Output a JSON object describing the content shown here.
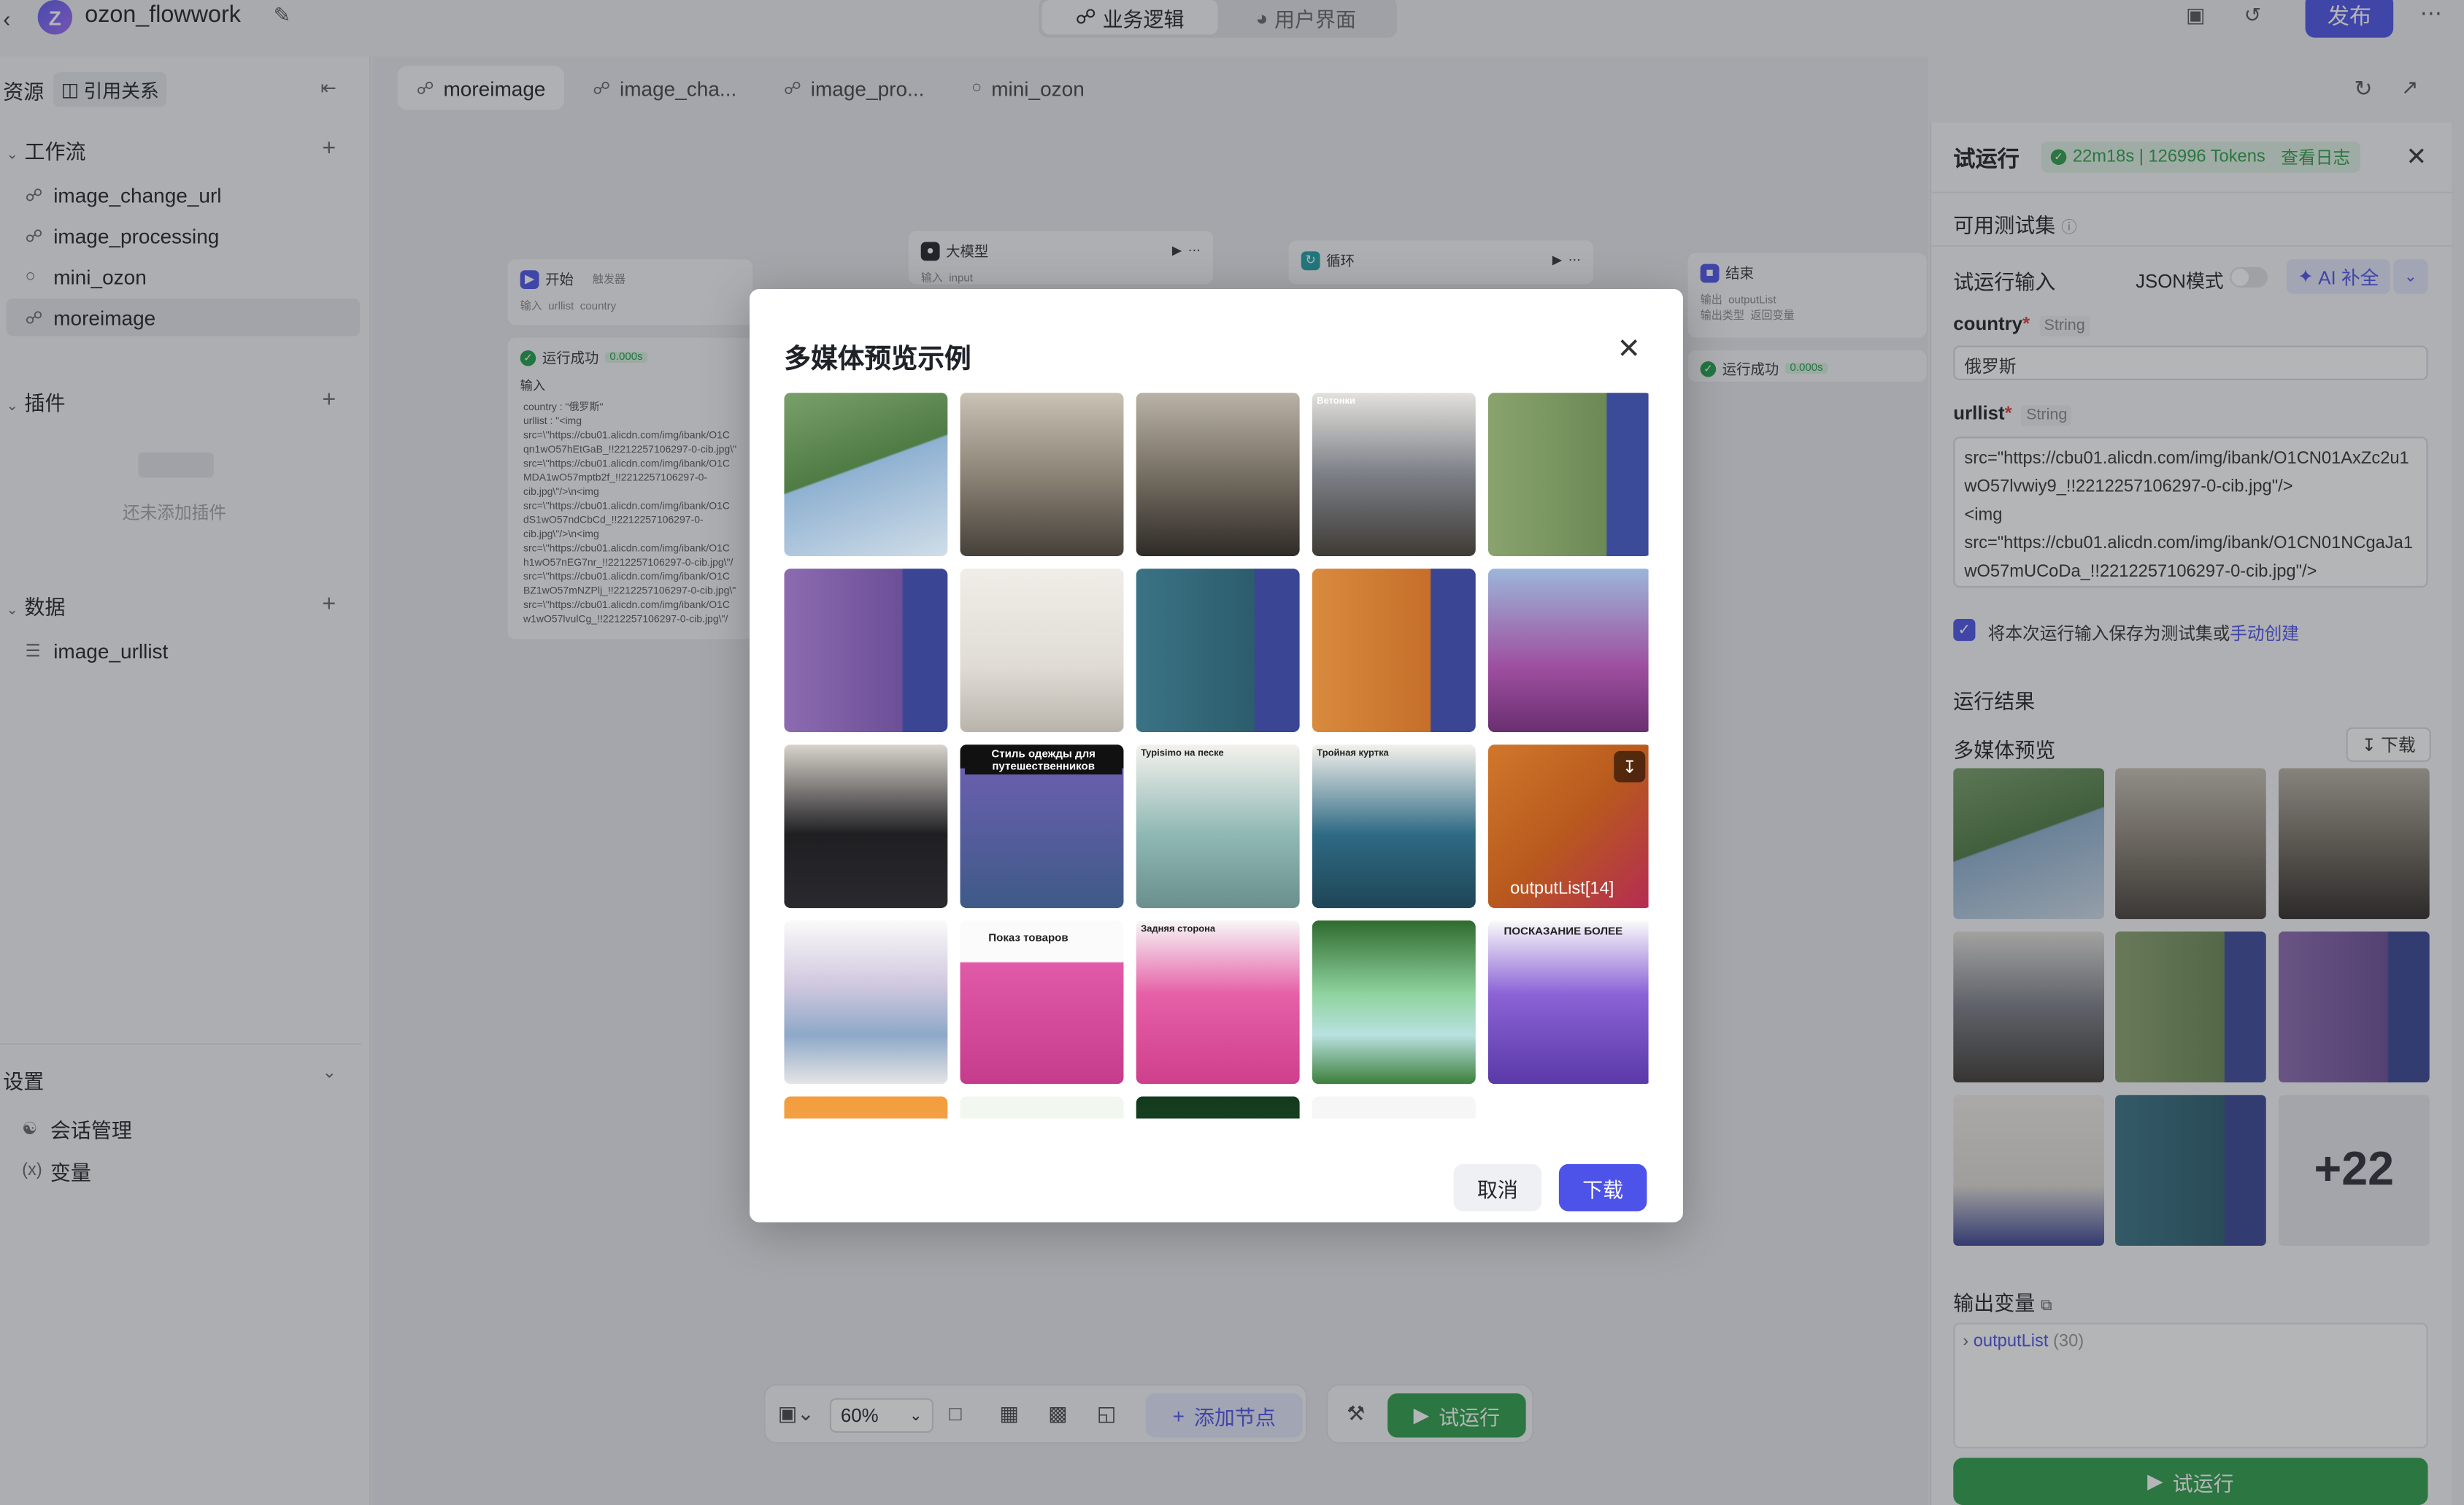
{
  "app": {
    "title": "ozon_flowwork",
    "tabs": [
      {
        "label": "业务逻辑",
        "icon": "flow-icon"
      },
      {
        "label": "用户界面",
        "icon": "palette-icon"
      }
    ],
    "publish_label": "发布"
  },
  "sidebar": {
    "resources_label": "资源",
    "references_label": "引用关系",
    "workflow_section": "工作流",
    "workflows": [
      {
        "label": "image_change_url",
        "icon": "workflow-icon"
      },
      {
        "label": "image_processing",
        "icon": "workflow-icon"
      },
      {
        "label": "mini_ozon",
        "icon": "chat-flow-icon"
      },
      {
        "label": "moreimage",
        "icon": "workflow-icon"
      }
    ],
    "plugin_section": "插件",
    "plugin_empty": "还未添加插件",
    "data_section": "数据",
    "data_items": [
      {
        "label": "image_urllist",
        "icon": "database-icon"
      }
    ],
    "settings_section": "设置",
    "settings_items": [
      {
        "label": "会话管理",
        "icon": "conversation-icon"
      },
      {
        "label": "变量",
        "icon": "variable-icon"
      }
    ]
  },
  "canvas": {
    "tabs": [
      {
        "label": "moreimage"
      },
      {
        "label": "image_cha..."
      },
      {
        "label": "image_pro..."
      },
      {
        "label": "mini_ozon"
      }
    ],
    "nodes": {
      "start": {
        "title": "开始",
        "tag": "触发器",
        "in_label": "输入",
        "fields": [
          "urllist",
          "country"
        ],
        "status": "运行成功",
        "time": "0.000s",
        "input_label": "输入",
        "code": "country : \"俄罗斯\"\nurllist : \"<img\nsrc=\\\"https://cbu01.alicdn.com/img/ibank/O1C\nqn1wO57hEtGaB_!!2212257106297-0-cib.jpg\\\"\nsrc=\\\"https://cbu01.alicdn.com/img/ibank/O1C\nMDA1wO57mptb2f_!!2212257106297-0-\ncib.jpg\\\"/>\\n<img\nsrc=\\\"https://cbu01.alicdn.com/img/ibank/O1C\ndS1wO57ndCbCd_!!2212257106297-0-\ncib.jpg\\\"/>\\n<img\nsrc=\\\"https://cbu01.alicdn.com/img/ibank/O1C\nh1wO57nEG7nr_!!2212257106297-0-cib.jpg\\\"/\nsrc=\\\"https://cbu01.alicdn.com/img/ibank/O1C\nBZ1wO57mNZPlj_!!2212257106297-0-cib.jpg\\\"\nsrc=\\\"https://cbu01.alicdn.com/img/ibank/O1C\nw1wO57lvulCg_!!2212257106297-0-cib.jpg\\\"/"
      },
      "llm": {
        "title": "大模型",
        "in_label": "输入",
        "field": "input"
      },
      "loop": {
        "title": "循环"
      },
      "end": {
        "title": "结束",
        "out_label": "输出",
        "field": "outputList",
        "out_type_label": "输出类型",
        "out_type": "返回变量",
        "status": "运行成功",
        "time": "0.000s"
      }
    },
    "zoom": "60%",
    "add_node_label": "添加节点",
    "run_label": "试运行"
  },
  "right_panel": {
    "title": "试运行",
    "badge": "22m18s | 126996 Tokens",
    "log_link": "查看日志",
    "test_set_label": "可用测试集",
    "input_label": "试运行输入",
    "json_mode_label": "JSON模式",
    "ai_fill_label": "AI 补全",
    "country_label": "country",
    "country_type": "String",
    "country_value": "俄罗斯",
    "urllist_label": "urllist",
    "urllist_type": "String",
    "urllist_value": "src=\"https://cbu01.alicdn.com/img/ibank/O1CN01AxZc2u1wO57lvwiy9_!!2212257106297-0-cib.jpg\"/>\n<img\nsrc=\"https://cbu01.alicdn.com/img/ibank/O1CN01NCgaJa1wO57mUCoDa_!!2212257106297-0-cib.jpg\"/>",
    "save_text": "将本次运行输入保存为测试集或",
    "save_link": "手动创建",
    "result_label": "运行结果",
    "media_preview_label": "多媒体预览",
    "download_label": "下载",
    "more_count": "+22",
    "output_var_label": "输出变量",
    "output_item": "outputList",
    "output_count": "(30)",
    "run_label": "试运行"
  },
  "modal": {
    "title": "多媒体预览示例",
    "hover_label": "outputList[14]",
    "cancel_label": "取消",
    "download_label": "下载",
    "image_texts": {
      "i3": "Ветонки",
      "i11": "Стиль одежды для путешественников",
      "i12": "Typisimo на песке",
      "i13": "Тройная куртка",
      "i16": "Показ товаров",
      "i17": "Задняя сторона",
      "i19": "ПОСКАЗАНИЕ БОЛЕЕ"
    }
  },
  "colors": {
    "accent": "#4d53e8",
    "success": "#2d9e4a"
  }
}
